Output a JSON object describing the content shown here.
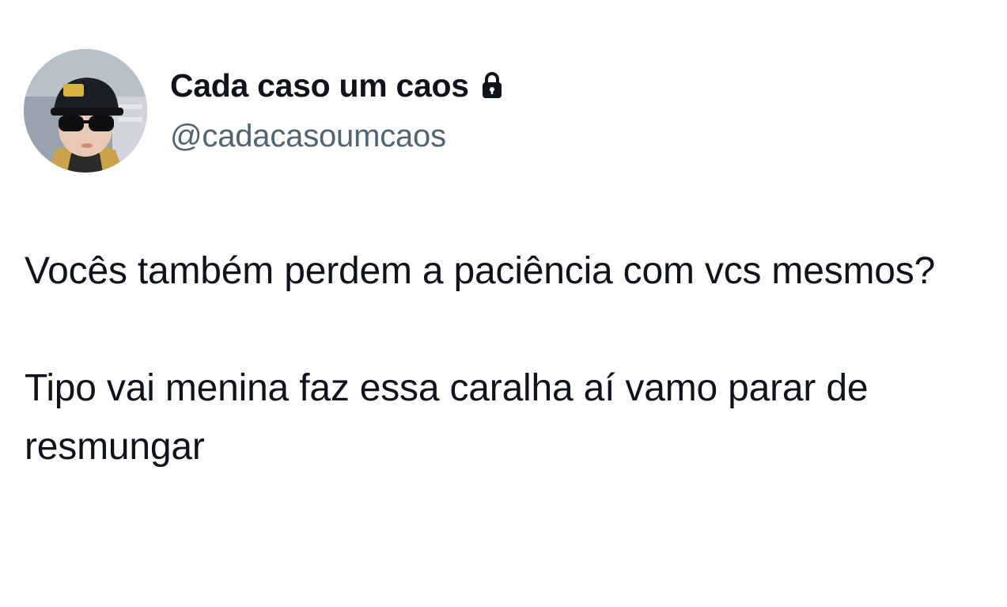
{
  "author": {
    "display_name": "Cada caso um caos",
    "handle": "@cadacasoumcaos",
    "avatar_icon": "avatar-photo",
    "protected_icon": "lock-icon"
  },
  "tweet": {
    "paragraphs": [
      "Vocês também perdem a paciência com vcs mesmos?",
      "Tipo vai menina faz essa caralha aí vamo parar de resmungar"
    ]
  },
  "colors": {
    "background": "#ffffff",
    "text_primary": "#0f1419",
    "text_secondary": "#536471"
  }
}
